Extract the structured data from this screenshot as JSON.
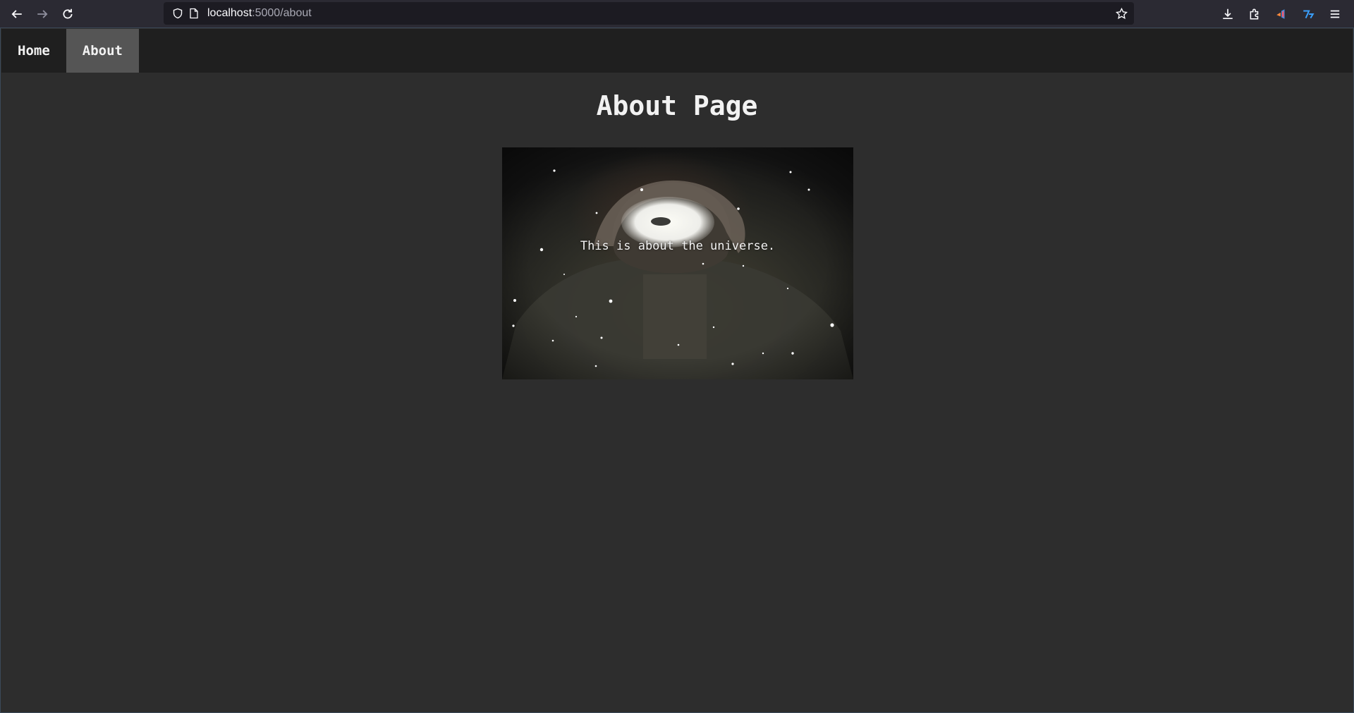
{
  "browser": {
    "url_host": "localhost",
    "url_rest": ":5000/about",
    "icons": [
      "back-arrow-icon",
      "forward-arrow-icon",
      "reload-icon",
      "shield-icon",
      "page-icon",
      "star-icon",
      "download-icon",
      "extensions-icon",
      "extension-a-icon",
      "extension-b-icon",
      "menu-icon"
    ]
  },
  "nav": {
    "items": [
      {
        "label": "Home",
        "active": false
      },
      {
        "label": "About",
        "active": true
      }
    ]
  },
  "main": {
    "title": "About Page",
    "image_caption": "This is about the universe."
  },
  "colors": {
    "page_bg": "#2d2d2d",
    "nav_bg": "#1f1f1f",
    "nav_active_bg": "#555555",
    "text": "#f2f2f2"
  }
}
